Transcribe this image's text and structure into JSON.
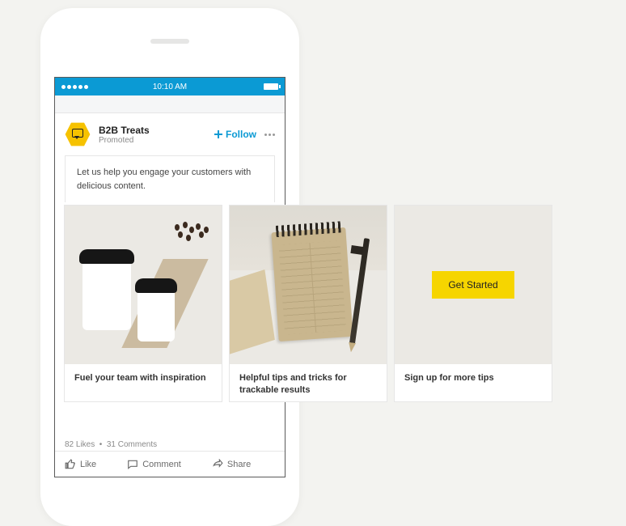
{
  "statusbar": {
    "time": "10:10 AM"
  },
  "post": {
    "company": "B2B Treats",
    "promoted_label": "Promoted",
    "follow_label": "Follow",
    "description": "Let us help you engage your customers with delicious content."
  },
  "cards": [
    {
      "caption": "Fuel your team with inspiration"
    },
    {
      "caption": "Helpful tips and tricks for trackable results"
    },
    {
      "caption": "Sign up for more tips",
      "cta": "Get Started"
    }
  ],
  "stats": {
    "likes": "82 Likes",
    "comments": "31 Comments"
  },
  "actions": {
    "like": "Like",
    "comment": "Comment",
    "share": "Share"
  }
}
